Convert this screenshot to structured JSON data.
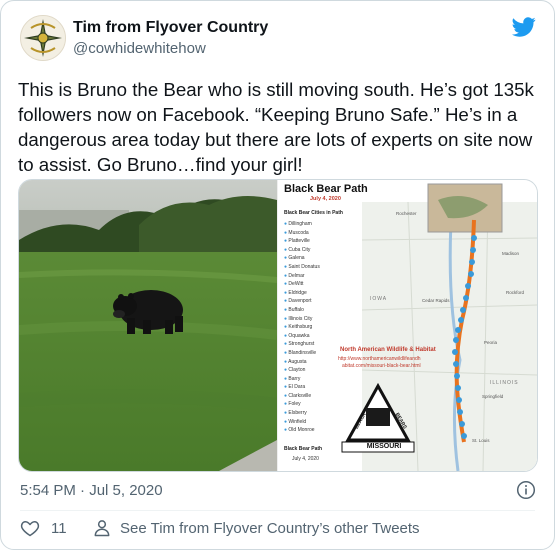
{
  "author": {
    "name": "Tim from Flyover Country",
    "handle": "@cowhidewhitehow"
  },
  "tweet": {
    "text": "This is Bruno the Bear who is still moving south.  He’s got 135k followers now on Facebook. “Keeping Bruno Safe.”  He’s in a dangerous area today but there are lots of experts on site now to assist.  Go Bruno…find your girl!"
  },
  "map_card": {
    "title": "Black Bear Path",
    "date": "July 4, 2020",
    "cities_header": "Black Bear Cities in Path",
    "cities": [
      "Dillingham",
      "Muscoda",
      "Platteville",
      "Cuba City",
      "Galena",
      "Saint Donatus",
      "Delmar",
      "DeWitt",
      "Eldridge",
      "Davenport",
      "Buffalo",
      "Illinois City",
      "Keithsburg",
      "Oquawka",
      "Stronghurst",
      "Blandinsville",
      "Augusta",
      "Clayton",
      "Barry",
      "El Dara",
      "Clarksville",
      "Foley",
      "Elsberry",
      "Winfield",
      "Old Monroe"
    ],
    "footer_label": "Black Bear Path",
    "footer_date": "July 4, 2020",
    "org_name": "North American Wildlife & Habitat",
    "org_url_1": "http://www.northamericanwildlifeandh",
    "org_url_2": "abitat.com/missouri-black-bear.html",
    "logo_text": "MISSOURI",
    "logo_word_1": "BLACK",
    "logo_word_2": "BEARS",
    "map_labels": [
      "Rochester",
      "IOWA",
      "Cedar Rapids",
      "Madison",
      "Rockford",
      "ILLINOIS",
      "Springfield",
      "St. Louis",
      "Peoria"
    ],
    "colors": {
      "title": "#111111",
      "date": "#c0392b",
      "path": "#e8731f",
      "marker": "#3a9ad9",
      "org_text": "#c0392b"
    }
  },
  "meta": {
    "timestamp": "5:54 PM · Jul 5, 2020"
  },
  "actions": {
    "like_count": "11",
    "other_tweets_label": "See Tim from Flyover Country’s other Tweets"
  },
  "icons": {
    "avatar": "military-insignia-avatar",
    "brand": "twitter-bird-icon",
    "info": "info-icon",
    "like": "heart-icon",
    "profile": "person-icon"
  },
  "colors": {
    "brand_blue": "#1d9bf0",
    "text_primary": "#0f1419",
    "text_secondary": "#536471",
    "border": "#cfd9de"
  }
}
